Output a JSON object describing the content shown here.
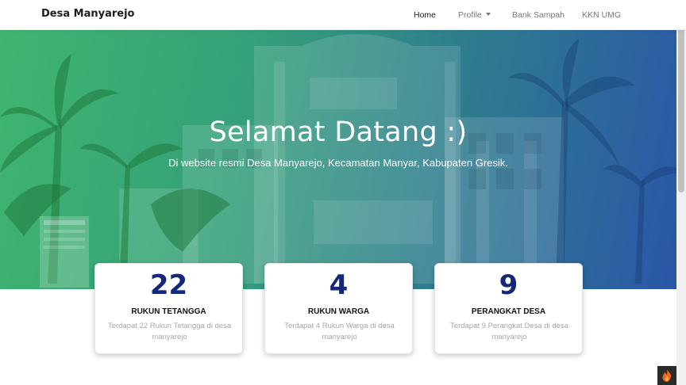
{
  "navbar": {
    "brand": "Desa Manyarejo",
    "links": [
      {
        "label": "Home",
        "active": true
      },
      {
        "label": "Profile",
        "dropdown": true
      },
      {
        "label": "Bank Sampah"
      },
      {
        "label": "KKN UMG"
      }
    ]
  },
  "hero": {
    "title": "Selamat Datang :)",
    "subtitle": "Di website resmi Desa Manyarejo, Kecamatan Manyar, Kabupaten Gresik."
  },
  "stats": [
    {
      "value": "22",
      "label": "RUKUN TETANGGA",
      "description": "Terdapat 22 Rukun Tetangga di desa manyarejo"
    },
    {
      "value": "4",
      "label": "RUKUN WARGA",
      "description": "Terdapat 4 Rukun Warga di desa manyarejo"
    },
    {
      "value": "9",
      "label": "PERANGKAT DESA",
      "description": "Terdapat 9 Perangkat Desa di desa manyarejo"
    }
  ],
  "colors": {
    "accent_number": "#15277a",
    "hero_green": "#3fb56e",
    "hero_blue": "#2a55a8"
  },
  "icons": {
    "floating_button": "flame-icon"
  }
}
